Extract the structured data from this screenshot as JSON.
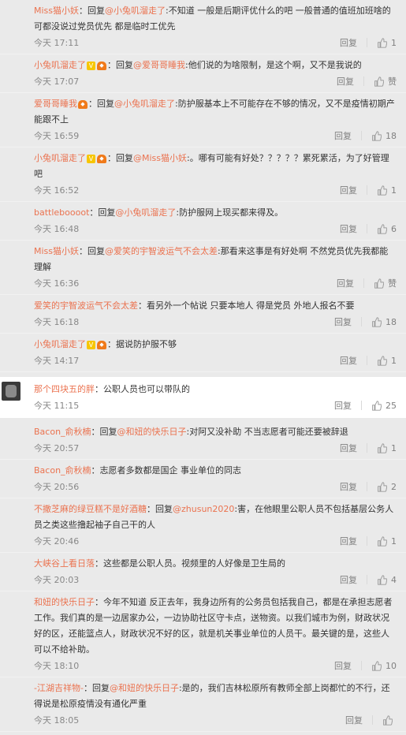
{
  "labels": {
    "reply": "回复",
    "like_zan": "赞"
  },
  "top_replies": [
    {
      "user": "Miss猫小妖",
      "badges": [],
      "prefix": "：回复",
      "mention": "@小兔叽溜走了",
      "text": ":不知道 一般是后期评优什么的吧 一般普通的值班加班啥的可都没说过党员优先 都是临时工优先",
      "time": "今天 17:11",
      "likes": "1"
    },
    {
      "user": "小兔叽溜走了",
      "badges": [
        "v",
        "hat"
      ],
      "prefix": "：回复",
      "mention": "@爱哥哥睡我",
      "text": ":他们说的为啥限制，是这个啊，又不是我说的",
      "time": "今天 17:07",
      "likes": "赞"
    },
    {
      "user": "爱哥哥睡我",
      "badges": [
        "hat"
      ],
      "prefix": "：回复",
      "mention": "@小兔叽溜走了",
      "text": ":防护服基本上不可能存在不够的情况，又不是疫情初期产能跟不上",
      "time": "今天 16:59",
      "likes": "18"
    },
    {
      "user": "小兔叽溜走了",
      "badges": [
        "v",
        "hat"
      ],
      "prefix": "：回复",
      "mention": "@Miss猫小妖",
      "text": ":。哪有可能有好处？？？？？累死累活，为了好管理吧",
      "time": "今天 16:52",
      "likes": "1"
    },
    {
      "user": "battleboooot",
      "badges": [],
      "prefix": "：回复",
      "mention": "@小兔叽溜走了",
      "text": ":防护服网上现买都来得及。",
      "time": "今天 16:48",
      "likes": "6"
    },
    {
      "user": "Miss猫小妖",
      "badges": [],
      "prefix": "：回复",
      "mention": "@爱笑的宇智波运气不会太差",
      "text": ":那看来这事是有好处啊 不然党员优先我都能理解",
      "time": "今天 16:36",
      "likes": "赞"
    },
    {
      "user": "爱笑的宇智波运气不会太差",
      "badges": [],
      "prefix": "",
      "mention": "",
      "text": "：看另外一个帖说 只要本地人 得是党员 外地人报名不要",
      "time": "今天 16:18",
      "likes": "18"
    },
    {
      "user": "小兔叽溜走了",
      "badges": [
        "v",
        "hat"
      ],
      "prefix": "",
      "mention": "",
      "text": "：据说防护服不够",
      "time": "今天 14:17",
      "likes": "1"
    }
  ],
  "main_comment": {
    "user": "那个四块五的胖",
    "text": "：公职人员也可以带队的",
    "time": "今天 11:15",
    "likes": "25"
  },
  "sub_replies": [
    {
      "user": "Bacon_俞秋楠",
      "badges": [],
      "prefix": "：回复",
      "mention": "@和妞的快乐日子",
      "text": ":对阿又没补助 不当志愿者可能还要被辞退",
      "time": "今天 20:57",
      "likes": "1"
    },
    {
      "user": "Bacon_俞秋楠",
      "badges": [],
      "prefix": "",
      "mention": "",
      "text": "：志愿者多数都是国企 事业单位的同志",
      "time": "今天 20:56",
      "likes": "2"
    },
    {
      "user": "不撒芝麻的绿豆糕不是好酒糖",
      "badges": [],
      "prefix": "：回复",
      "mention": "@zhusun2020",
      "text": ":害，在他眼里公职人员不包括基层公务人员之类这些撸起袖子自己干的人",
      "time": "今天 20:46",
      "likes": "1"
    },
    {
      "user": "大峡谷上看日落",
      "badges": [],
      "prefix": "",
      "mention": "",
      "text": "：这些都是公职人员。视频里的人好像是卫生局的",
      "time": "今天 20:03",
      "likes": "4"
    },
    {
      "user": "和妞的快乐日子",
      "badges": [],
      "prefix": "",
      "mention": "",
      "text": "：今年不知道 反正去年，我身边所有的公务员包括我自己，都是在承担志愿者工作。我们真的是一边居家办公，一边协助社区守卡点，送物资。以我们城市为例，财政状况好的区，还能篮点人，财政状况不好的区，就是机关事业单位的人员干。最关键的是，这些人可以不给补助。",
      "time": "今天 18:10",
      "likes": "10"
    },
    {
      "user": "-江湖吉祥物-",
      "badges": [],
      "prefix": "：回复",
      "mention": "@和妞的快乐日子",
      "text": ":是的，我们吉林松原所有教师全部上岗都忙的不行，还得说是松原疫情没有通化严重",
      "time": "今天 18:05",
      "likes": ""
    }
  ]
}
